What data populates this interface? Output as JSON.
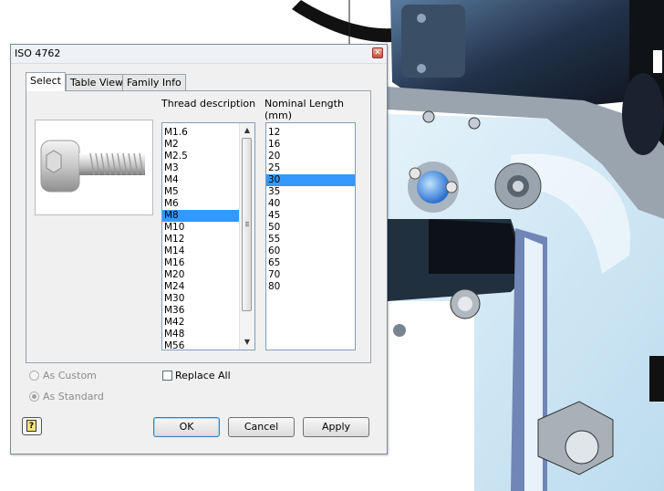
{
  "dialog": {
    "title": "ISO 4762",
    "close_glyph": "✕"
  },
  "tabs": [
    {
      "label": "Select"
    },
    {
      "label": "Table View"
    },
    {
      "label": "Family Info"
    }
  ],
  "thread": {
    "header": "Thread description",
    "items": [
      "M1.6",
      "M2",
      "M2.5",
      "M3",
      "M4",
      "M5",
      "M6",
      "M8",
      "M10",
      "M12",
      "M14",
      "M16",
      "M20",
      "M24",
      "M30",
      "M36",
      "M42",
      "M48",
      "M56"
    ],
    "selected": "M8"
  },
  "length": {
    "header_line1": "Nominal Length",
    "header_line2": "(mm)",
    "items": [
      "12",
      "16",
      "20",
      "25",
      "30",
      "35",
      "40",
      "45",
      "50",
      "55",
      "60",
      "65",
      "70",
      "80"
    ],
    "selected": "30"
  },
  "options": {
    "as_custom": "As Custom",
    "as_standard": "As Standard",
    "replace_all": "Replace All"
  },
  "buttons": {
    "ok": "OK",
    "cancel": "Cancel",
    "apply": "Apply",
    "help_glyph": "?"
  },
  "colors": {
    "selection": "#3399ff",
    "cad_part": "#c8e6f5",
    "cad_dark": "#1c2430"
  },
  "icons": [
    "close-icon",
    "scroll-up-arrow-icon",
    "scroll-down-arrow-icon",
    "help-icon",
    "bolt-preview-icon"
  ]
}
